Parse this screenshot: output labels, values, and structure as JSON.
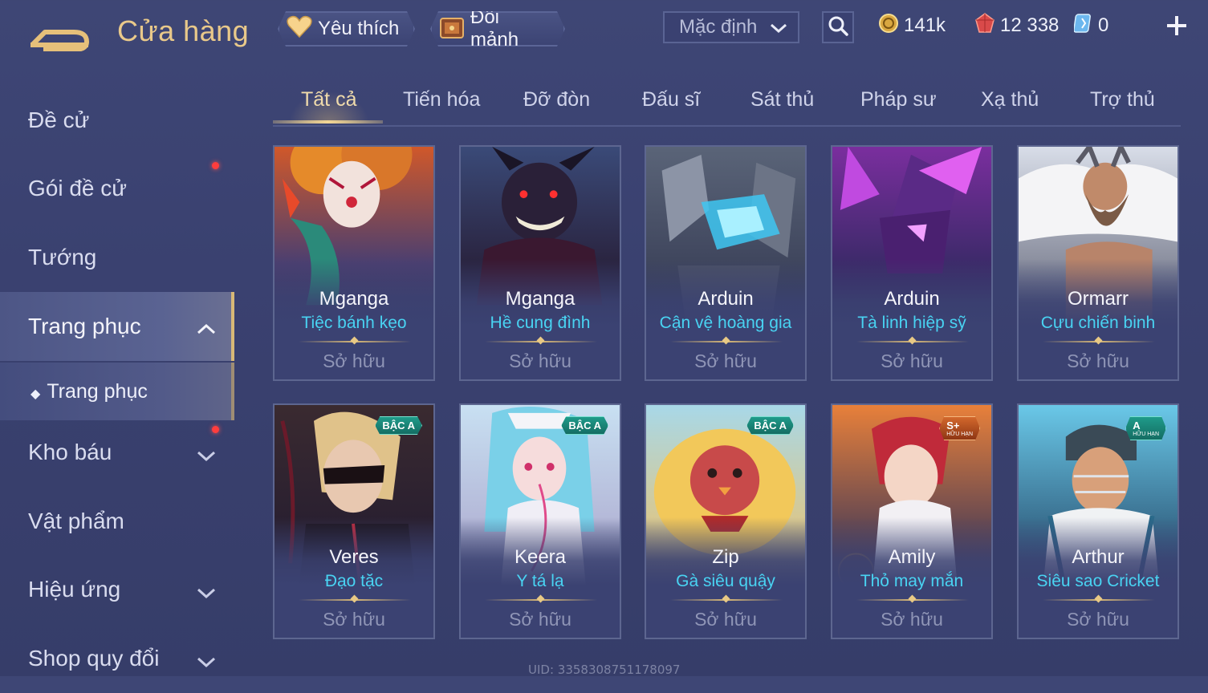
{
  "header": {
    "title": "Cửa hàng",
    "favorites_label": "Yêu thích",
    "exchange_label": "Đổi mảnh",
    "sort_value": "Mặc định",
    "gold": "141k",
    "voucher": "12 338",
    "quan_huy": "0"
  },
  "sidebar": {
    "items": [
      {
        "label": "Đề cử"
      },
      {
        "label": "Gói đề cử"
      },
      {
        "label": "Tướng"
      },
      {
        "label": "Trang phục"
      },
      {
        "label": "Kho báu"
      },
      {
        "label": "Vật phẩm"
      },
      {
        "label": "Hiệu ứng"
      },
      {
        "label": "Shop quy đổi"
      }
    ],
    "sub_item": "Trang phục"
  },
  "tabs": [
    "Tất cả",
    "Tiến hóa",
    "Đỡ đòn",
    "Đấu sĩ",
    "Sát thủ",
    "Pháp sư",
    "Xạ thủ",
    "Trợ thủ"
  ],
  "cards": [
    {
      "hero": "Mganga",
      "skin": "Tiệc bánh kẹo",
      "status": "Sở hữu"
    },
    {
      "hero": "Mganga",
      "skin": "Hề cung đình",
      "status": "Sở hữu"
    },
    {
      "hero": "Arduin",
      "skin": "Cận vệ hoàng gia",
      "status": "Sở hữu"
    },
    {
      "hero": "Arduin",
      "skin": "Tà linh hiệp sỹ",
      "status": "Sở hữu"
    },
    {
      "hero": "Ormarr",
      "skin": "Cựu chiến binh",
      "status": "Sở hữu"
    },
    {
      "hero": "Veres",
      "skin": "Đạo tặc",
      "status": "Sở hữu",
      "badge": "BẬC A"
    },
    {
      "hero": "Keera",
      "skin": "Y tá lạ",
      "status": "Sở hữu",
      "badge": "BẬC A"
    },
    {
      "hero": "Zip",
      "skin": "Gà siêu quậy",
      "status": "Sở hữu",
      "badge": "BẬC A"
    },
    {
      "hero": "Amily",
      "skin": "Thỏ may mắn",
      "status": "Sở hữu",
      "badge": "S+",
      "badge_sub": "HỮU HẠN"
    },
    {
      "hero": "Arthur",
      "skin": "Siêu sao Cricket",
      "status": "Sở hữu",
      "badge": "A",
      "badge_sub": "HỮU HẠN"
    }
  ],
  "uid": "UID: 3358308751178097",
  "colors": {
    "background": "#3a4170",
    "accent_gold": "#e9c98a",
    "skin_name": "#49d3f2",
    "owned_text": "#8f95b6",
    "notification": "#ff3d3d"
  }
}
